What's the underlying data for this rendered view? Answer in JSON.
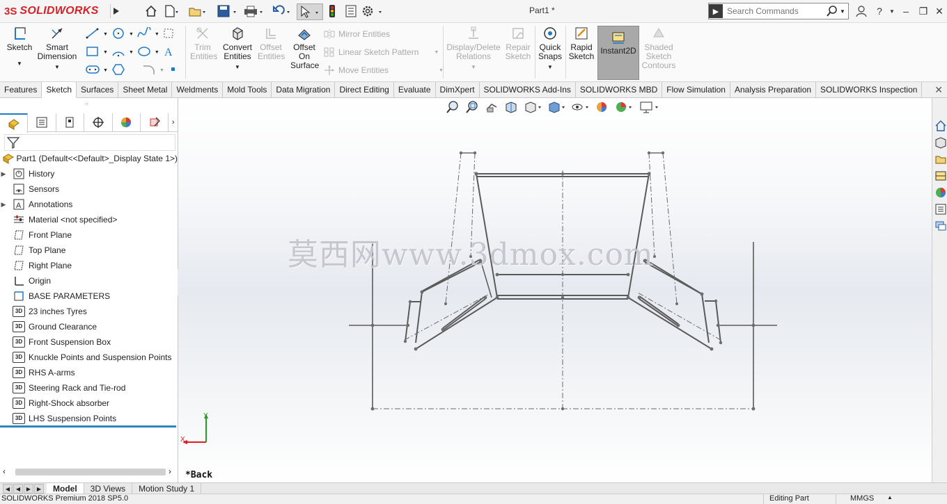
{
  "app": {
    "brand_prefix": "3S",
    "brand_name": "SOLIDWORKS",
    "document_title": "Part1 *"
  },
  "search": {
    "placeholder": "Search Commands"
  },
  "ribbon": {
    "sketch": "Sketch",
    "smart_dimension": "Smart Dimension",
    "trim_entities": "Trim Entities",
    "convert_entities": "Convert Entities",
    "offset_entities": "Offset Entities",
    "offset_on_surface": "Offset On Surface",
    "mirror_entities": "Mirror Entities",
    "linear_sketch_pattern": "Linear Sketch Pattern",
    "move_entities": "Move Entities",
    "display_delete_relations": "Display/Delete Relations",
    "repair_sketch": "Repair Sketch",
    "quick_snaps": "Quick Snaps",
    "rapid_sketch": "Rapid Sketch",
    "instant2d": "Instant2D",
    "shaded_sketch_contours": "Shaded Sketch Contours"
  },
  "tabs": [
    "Features",
    "Sketch",
    "Surfaces",
    "Sheet Metal",
    "Weldments",
    "Mold Tools",
    "Data Migration",
    "Direct Editing",
    "Evaluate",
    "DimXpert",
    "SOLIDWORKS Add-Ins",
    "SOLIDWORKS MBD",
    "Flow Simulation",
    "Analysis Preparation",
    "SOLIDWORKS Inspection"
  ],
  "active_tab": "Sketch",
  "tree": {
    "root": "Part1  (Default<<Default>_Display State 1>)",
    "items": [
      {
        "label": "History",
        "icon": "history-icon",
        "expandable": true
      },
      {
        "label": "Sensors",
        "icon": "sensors-icon",
        "expandable": false
      },
      {
        "label": "Annotations",
        "icon": "annotations-icon",
        "expandable": true
      },
      {
        "label": "Material <not specified>",
        "icon": "material-icon",
        "expandable": false
      },
      {
        "label": "Front Plane",
        "icon": "plane-icon",
        "expandable": false
      },
      {
        "label": "Top Plane",
        "icon": "plane-icon",
        "expandable": false
      },
      {
        "label": "Right Plane",
        "icon": "plane-icon",
        "expandable": false
      },
      {
        "label": "Origin",
        "icon": "origin-icon",
        "expandable": false
      },
      {
        "label": "BASE PARAMETERS",
        "icon": "sketch-icon",
        "expandable": false
      },
      {
        "label": "23 inches Tyres",
        "icon": "3d-sketch-icon",
        "expandable": false
      },
      {
        "label": "Ground Clearance",
        "icon": "3d-sketch-icon",
        "expandable": false
      },
      {
        "label": "Front Suspension Box",
        "icon": "3d-sketch-icon",
        "expandable": false
      },
      {
        "label": "Knuckle Points and Suspension Points",
        "icon": "3d-sketch-icon",
        "expandable": false
      },
      {
        "label": "RHS A-arms",
        "icon": "3d-sketch-icon",
        "expandable": false
      },
      {
        "label": "Steering Rack and Tie-rod",
        "icon": "3d-sketch-icon",
        "expandable": false
      },
      {
        "label": "Right-Shock absorber",
        "icon": "3d-sketch-icon",
        "expandable": false
      },
      {
        "label": "LHS Suspension Points",
        "icon": "3d-sketch-icon",
        "expandable": false
      }
    ],
    "badge_3d": "3D"
  },
  "graphics": {
    "watermark": "莫西网www.3dmox.com",
    "view_label": "*Back",
    "triad_x": "X",
    "triad_y": "Y"
  },
  "bottom_tabs": [
    "Model",
    "3D Views",
    "Motion Study 1"
  ],
  "active_bottom_tab": "Model",
  "status": {
    "product": "SOLIDWORKS Premium 2018 SP5.0",
    "mode": "Editing Part",
    "units": "MMGS"
  },
  "colors": {
    "brand_red": "#d2232a",
    "active_blue": "#1f7ac9",
    "sketch_line": "#5a5a5a",
    "instant2d_bg": "#a9a9a9"
  }
}
